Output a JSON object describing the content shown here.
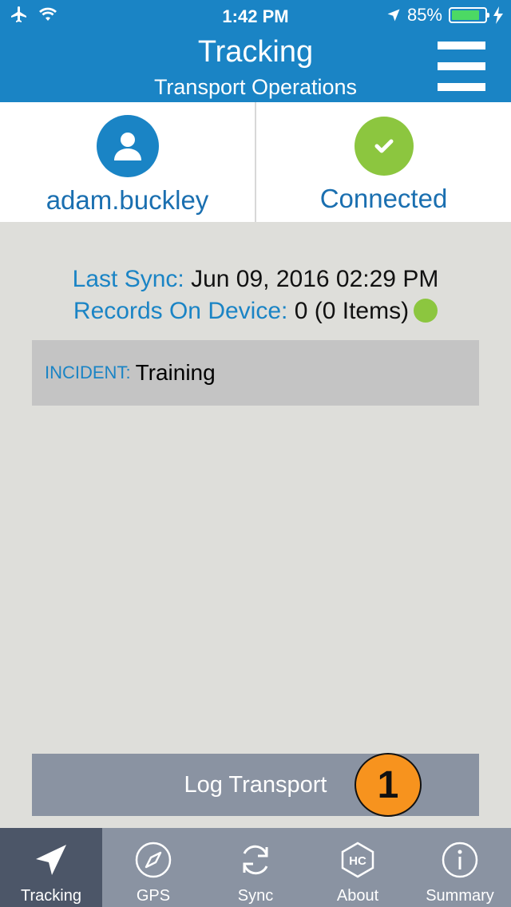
{
  "status_bar": {
    "time": "1:42 PM",
    "battery": "85%",
    "battery_level": 0.85
  },
  "header": {
    "title": "Tracking",
    "subtitle": "Transport Operations"
  },
  "cards": {
    "user": {
      "label": "adam.buckley",
      "icon": "user-icon"
    },
    "connection": {
      "label": "Connected",
      "icon": "check-icon"
    }
  },
  "sync": {
    "last_sync_label": "Last Sync:",
    "last_sync_value": "Jun 09, 2016 02:29 PM",
    "records_label": "Records On Device:",
    "records_value": "0 (0 Items)"
  },
  "incident": {
    "label": "INCIDENT:",
    "value": "Training"
  },
  "log_button": {
    "label": "Log Transport",
    "badge": "1"
  },
  "tabs": [
    {
      "label": "Tracking",
      "icon": "location-arrow-icon"
    },
    {
      "label": "GPS",
      "icon": "compass-icon"
    },
    {
      "label": "Sync",
      "icon": "sync-icon"
    },
    {
      "label": "About",
      "icon": "hc-logo-icon"
    },
    {
      "label": "Summary",
      "icon": "info-icon"
    }
  ],
  "colors": {
    "brand": "#1a84c5",
    "success": "#8cc63f",
    "badge": "#f7931e",
    "tabbar": "#8a93a2",
    "tab_active": "#4c5668"
  }
}
